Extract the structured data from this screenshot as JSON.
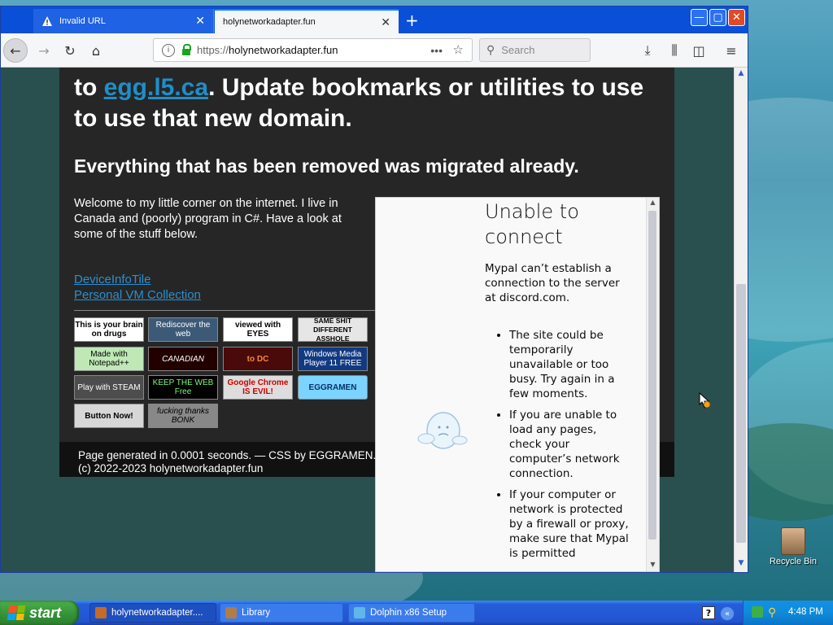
{
  "browser": {
    "tabs": [
      {
        "label": "Invalid URL",
        "icon": "warning-icon",
        "active": false
      },
      {
        "label": "holynetworkadapter.fun",
        "icon": "none",
        "active": true
      }
    ],
    "url_protocol": "https://",
    "url_host": "holynetworkadapter.fun",
    "search_placeholder": "Search"
  },
  "page": {
    "heading1_prefix": "to ",
    "heading1_link": "egg.l5.ca",
    "heading1_suffix": ". Update bookmarks or utilities to use to use that new domain.",
    "heading2": "Everything that has been removed was migrated already.",
    "intro": "Welcome to my little corner on the internet. I live in Canada and (poorly) program in C#. Have a look at some of the stuff below.",
    "links": [
      "DeviceInfoTile",
      "Personal VM Collection"
    ],
    "badges": [
      "This is your brain on drugs",
      "Rediscover the web",
      "viewed with EYES",
      "SAME SHIT DIFFERENT ASSHOLE",
      "Made with Notepad++",
      "CANADIAN",
      "to DC",
      "Windows Media Player 11 FREE",
      "Play with STEAM",
      "KEEP THE WEB Free",
      "Google Chrome IS EVIL!",
      "EGGRAMEN",
      "Button Now!",
      "fucking thanks BONK"
    ],
    "footer": "Page generated in 0.0001 seconds. — CSS by EGGRAMEN. (c) 2022-2023 holynetworkadapter.fun"
  },
  "error_frame": {
    "title": "Unable to connect",
    "message": "Mypal can’t establish a connection to the server at discord.com.",
    "bullets": [
      "The site could be temporarily unavailable or too busy. Try again in a few moments.",
      "If you are unable to load any pages, check your computer’s network connection.",
      "If your computer or network is protected by a firewall or proxy, make sure that Mypal is permitted"
    ]
  },
  "desktop": {
    "recycle_bin": "Recycle Bin"
  },
  "taskbar": {
    "start": "start",
    "tasks": [
      "holynetworkadapter....",
      "Library",
      "Dolphin x86 Setup"
    ],
    "clock": "4:48 PM"
  }
}
